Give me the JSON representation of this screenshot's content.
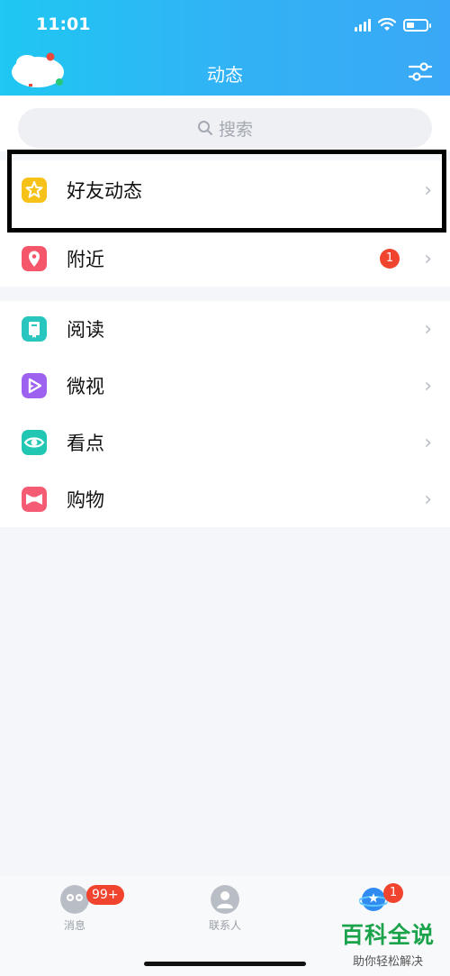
{
  "status_bar": {
    "time": "11:01"
  },
  "header": {
    "title": "动态"
  },
  "search": {
    "placeholder": "搜索"
  },
  "group1": [
    {
      "label": "好友动态",
      "icon": "star-icon",
      "color": "#f6c21a"
    },
    {
      "label": "附近",
      "icon": "location-pin-icon",
      "color": "#f5566a",
      "badge": "1"
    }
  ],
  "group2": [
    {
      "label": "阅读",
      "icon": "book-icon",
      "color": "#29c6bf"
    },
    {
      "label": "微视",
      "icon": "play-icon",
      "color": "#9e62f0"
    },
    {
      "label": "看点",
      "icon": "eye-icon",
      "color": "#22c7b4"
    },
    {
      "label": "购物",
      "icon": "bow-icon",
      "color": "#f55b73"
    }
  ],
  "tabbar": {
    "messages": {
      "label": "消息",
      "badge": "99+"
    },
    "contacts": {
      "label": "联系人"
    },
    "dynamics": {
      "badge": "1"
    }
  },
  "watermark": {
    "main": "百科全说",
    "sub": "助你轻松解决"
  },
  "colors": {
    "accent": "#31b3f5",
    "badge": "#f1442f",
    "brand_green": "#1aa34a"
  }
}
